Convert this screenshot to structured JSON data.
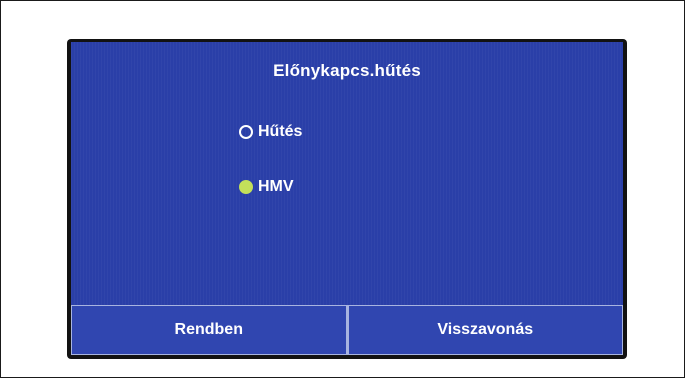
{
  "dialog": {
    "title": "Előnykapcs.hűtés",
    "options": [
      {
        "label": "Hűtés",
        "selected": false
      },
      {
        "label": "HMV",
        "selected": true
      }
    ]
  },
  "buttons": {
    "ok_label": "Rendben",
    "cancel_label": "Visszavonás"
  },
  "colors": {
    "screen_background": "#2a3fa8",
    "selected_radio": "#c3e05a",
    "text": "#ffffff"
  }
}
